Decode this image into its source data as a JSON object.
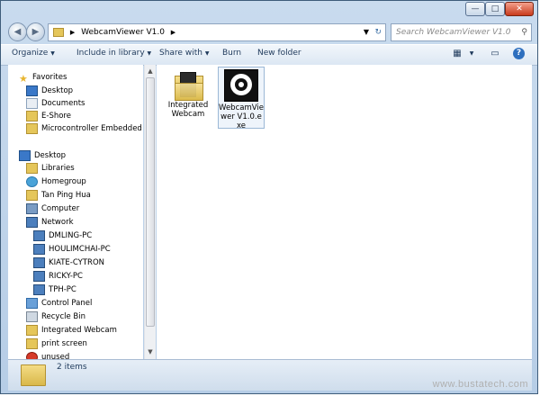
{
  "address": {
    "path": "WebcamViewer V1.0",
    "search_placeholder": "Search WebcamViewer V1.0"
  },
  "toolbar": {
    "organize": "Organize",
    "include_in_library": "Include in library",
    "share_with": "Share with",
    "burn": "Burn",
    "new_folder": "New folder"
  },
  "nav": {
    "favorites": "Favorites",
    "favorite_items": [
      "Desktop",
      "Documents",
      "E-Shore",
      "Microcontroller Embedded Syst"
    ],
    "desktop": "Desktop",
    "desktop_items": [
      "Libraries",
      "Homegroup",
      "Tan Ping Hua",
      "Computer",
      "Network"
    ],
    "network_items": [
      "DMLING-PC",
      "HOULIMCHAI-PC",
      "KIATE-CYTRON",
      "RICKY-PC",
      "TPH-PC"
    ],
    "other_items": [
      "Control Panel",
      "Recycle Bin",
      "Integrated Webcam",
      "print screen",
      "unused"
    ]
  },
  "files": [
    {
      "name": "Integrated Webcam",
      "icon": "folder-icon"
    },
    {
      "name": "WebcamViewer V1.0.exe",
      "icon": "webcam-exe-icon"
    }
  ],
  "status": {
    "count": "2 items"
  },
  "watermark": "www.bustatech.com"
}
